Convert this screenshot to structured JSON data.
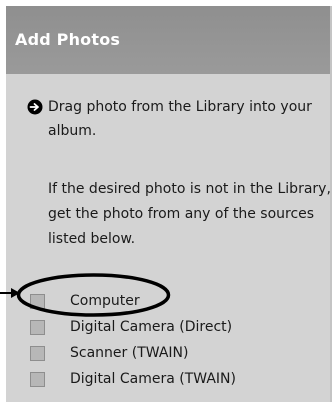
{
  "panel": {
    "title": "Add Photos"
  },
  "instruction": {
    "icon": "arrow-right-circle-icon",
    "text": "Drag photo from the Library into your album."
  },
  "note": {
    "text": "If the desired photo is not in the Library, get the photo from any of the sources listed below."
  },
  "sources": {
    "items": [
      {
        "label": "Computer",
        "checked": false,
        "highlighted": true
      },
      {
        "label": "Digital Camera (Direct)",
        "checked": false,
        "highlighted": false
      },
      {
        "label": "Scanner (TWAIN)",
        "checked": false,
        "highlighted": false
      },
      {
        "label": "Digital Camera (TWAIN)",
        "checked": false,
        "highlighted": false
      }
    ]
  },
  "annotation": {
    "highlight_color": "#000000",
    "panel_color": "#d3d3d3",
    "header_color": "#959595"
  }
}
